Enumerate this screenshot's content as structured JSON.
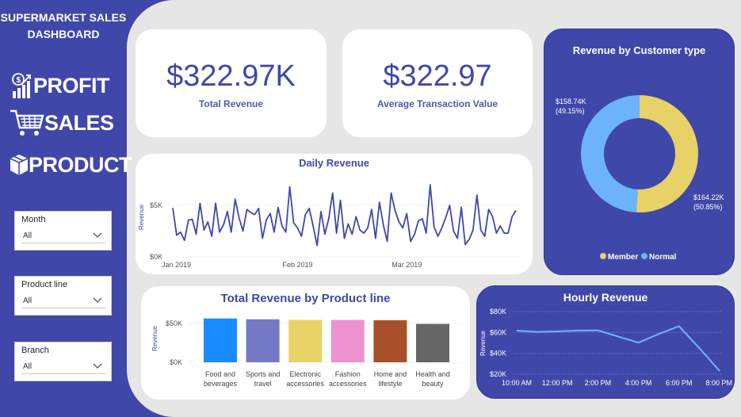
{
  "sidebar": {
    "title_line1": "SUPERMARKET SALES",
    "title_line2": "DASHBOARD",
    "nav": [
      {
        "label": "PROFIT",
        "icon": "profit-chart-icon"
      },
      {
        "label": "SALES",
        "icon": "shopping-cart-icon"
      },
      {
        "label": "PRODUCT",
        "icon": "box-icon"
      }
    ],
    "slicers": [
      {
        "label": "Month",
        "value": "All"
      },
      {
        "label": "Product line",
        "value": "All"
      },
      {
        "label": "Branch",
        "value": "All"
      }
    ]
  },
  "kpis": [
    {
      "value": "$322.97K",
      "label": "Total Revenue"
    },
    {
      "value": "$322.97",
      "label": "Average Transaction Value"
    }
  ],
  "colors": {
    "primary": "#3f48a8",
    "background": "#e6e6e6",
    "line": "#3f48a8",
    "hourly_line": "#6fb3ff"
  },
  "chart_data": [
    {
      "id": "customer-type",
      "type": "pie",
      "title": "Revenue by Customer type",
      "slices": [
        {
          "name": "Member",
          "value": 164.22,
          "label": "$164.22K",
          "pct": "(50.85%)",
          "color": "#e8d166"
        },
        {
          "name": "Normal",
          "value": 158.74,
          "label": "$158.74K",
          "pct": "(49.15%)",
          "color": "#6cb3fb"
        }
      ],
      "legend_position": "bottom"
    },
    {
      "id": "daily-revenue",
      "type": "line",
      "title": "Daily Revenue",
      "ylabel": "Revenue",
      "y_ticks": [
        "$0K",
        "$5K"
      ],
      "x_ticks": [
        "Jan 2019",
        "Feb 2019",
        "Mar 2019"
      ],
      "ylim": [
        0,
        8000
      ],
      "x": [
        "2019-01-01",
        "2019-01-02",
        "2019-01-03",
        "2019-01-04",
        "2019-01-05",
        "2019-01-06",
        "2019-01-07",
        "2019-01-08",
        "2019-01-09",
        "2019-01-10",
        "2019-01-11",
        "2019-01-12",
        "2019-01-13",
        "2019-01-14",
        "2019-01-15",
        "2019-01-16",
        "2019-01-17",
        "2019-01-18",
        "2019-01-19",
        "2019-01-20",
        "2019-01-21",
        "2019-01-22",
        "2019-01-23",
        "2019-01-24",
        "2019-01-25",
        "2019-01-26",
        "2019-01-27",
        "2019-01-28",
        "2019-01-29",
        "2019-01-30",
        "2019-01-31",
        "2019-02-01",
        "2019-02-02",
        "2019-02-03",
        "2019-02-04",
        "2019-02-05",
        "2019-02-06",
        "2019-02-07",
        "2019-02-08",
        "2019-02-09",
        "2019-02-10",
        "2019-02-11",
        "2019-02-12",
        "2019-02-13",
        "2019-02-14",
        "2019-02-15",
        "2019-02-16",
        "2019-02-17",
        "2019-02-18",
        "2019-02-19",
        "2019-02-20",
        "2019-02-21",
        "2019-02-22",
        "2019-02-23",
        "2019-02-24",
        "2019-02-25",
        "2019-02-26",
        "2019-02-27",
        "2019-02-28",
        "2019-03-01",
        "2019-03-02",
        "2019-03-03",
        "2019-03-04",
        "2019-03-05",
        "2019-03-06",
        "2019-03-07",
        "2019-03-08",
        "2019-03-09",
        "2019-03-10",
        "2019-03-11",
        "2019-03-12",
        "2019-03-13",
        "2019-03-14",
        "2019-03-15",
        "2019-03-16",
        "2019-03-17",
        "2019-03-18",
        "2019-03-19",
        "2019-03-20",
        "2019-03-21",
        "2019-03-22",
        "2019-03-23",
        "2019-03-24",
        "2019-03-25",
        "2019-03-26",
        "2019-03-27",
        "2019-03-28",
        "2019-03-29",
        "2019-03-30"
      ],
      "values": [
        4750,
        2100,
        2400,
        1600,
        3550,
        3650,
        2200,
        5200,
        2600,
        3400,
        2000,
        5200,
        2400,
        3100,
        4400,
        2400,
        5600,
        3800,
        2500,
        4600,
        4300,
        4100,
        4700,
        1800,
        3600,
        4200,
        2400,
        4800,
        3000,
        2400,
        6800,
        3300,
        2800,
        2000,
        4100,
        4700,
        3000,
        1100,
        4400,
        2200,
        3700,
        6200,
        2300,
        5500,
        1800,
        3200,
        2200,
        3900,
        2600,
        2300,
        2800,
        4600,
        1800,
        5300,
        3100,
        1500,
        6200,
        4500,
        3400,
        2800,
        4200,
        1500,
        2200,
        3500,
        3700,
        2300,
        7000,
        2900,
        2000,
        2800,
        3800,
        5000,
        2500,
        1800,
        4800,
        1200,
        1700,
        2600,
        6000,
        2600,
        2000,
        4600,
        3900,
        2300,
        3000,
        2300,
        2300,
        3900,
        4500
      ]
    },
    {
      "id": "product-line",
      "type": "bar",
      "title": "Total Revenue by Product line",
      "ylabel": "Revenue",
      "y_ticks": [
        "$0K",
        "$50K"
      ],
      "ylim": [
        0,
        65000
      ],
      "categories": [
        [
          "Food and",
          "beverages"
        ],
        [
          "Sports and",
          "travel"
        ],
        [
          "Electronic",
          "accessories"
        ],
        [
          "Fashion",
          "accessories"
        ],
        [
          "Home and",
          "lifestyle"
        ],
        [
          "Health and",
          "beauty"
        ]
      ],
      "values": [
        56145,
        55123,
        54338,
        54306,
        53862,
        49194
      ],
      "colors": [
        "#1a8cff",
        "#7479c6",
        "#e8d166",
        "#ec92d0",
        "#a8502a",
        "#666666"
      ]
    },
    {
      "id": "hourly-revenue",
      "type": "line",
      "title": "Hourly Revenue",
      "ylabel": "Revenue",
      "y_ticks": [
        "$20K",
        "$40K",
        "$60K",
        "$80K"
      ],
      "ylim": [
        20000,
        80000
      ],
      "x_ticks": [
        "10:00 AM",
        "12:00 PM",
        "2:00 PM",
        "4:00 PM",
        "6:00 PM",
        "8:00 PM"
      ],
      "x": [
        10,
        11,
        12,
        13,
        14,
        15,
        16,
        17,
        18,
        19,
        20
      ],
      "values": [
        61800,
        60500,
        61000,
        61800,
        62000,
        56000,
        50200,
        58500,
        66000,
        45000,
        23000
      ]
    }
  ]
}
